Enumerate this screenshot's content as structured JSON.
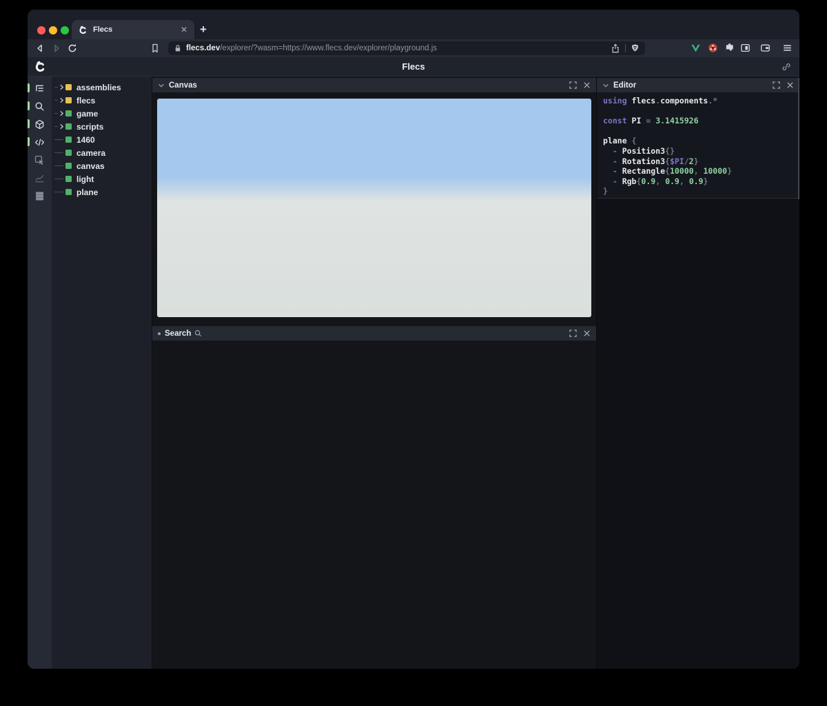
{
  "browser": {
    "tab_title": "Flecs",
    "new_tab_label": "+",
    "address": {
      "domain": "flecs.dev",
      "path": "/explorer/?wasm=https://www.flecs.dev/explorer/playground.js"
    }
  },
  "app_header": {
    "title": "Flecs"
  },
  "sidebar": {
    "icons": [
      {
        "name": "entity-tree",
        "active": true,
        "level": "bright"
      },
      {
        "name": "search",
        "active": true,
        "level": "bright"
      },
      {
        "name": "cube",
        "active": true,
        "level": "bright"
      },
      {
        "name": "code",
        "active": true,
        "level": "bright"
      },
      {
        "name": "inspect",
        "active": false,
        "level": "mid"
      },
      {
        "name": "stats",
        "active": false,
        "level": "dim"
      },
      {
        "name": "rows",
        "active": false,
        "level": "mid"
      }
    ]
  },
  "tree": {
    "items": [
      {
        "label": "assemblies",
        "color": "#e5c150",
        "expandable": true
      },
      {
        "label": "flecs",
        "color": "#e5c150",
        "expandable": true
      },
      {
        "label": "game",
        "color": "#50b26a",
        "expandable": true
      },
      {
        "label": "scripts",
        "color": "#50b26a",
        "expandable": true
      },
      {
        "label": "1460",
        "color": "#50b26a",
        "expandable": false
      },
      {
        "label": "camera",
        "color": "#50b26a",
        "expandable": false
      },
      {
        "label": "canvas",
        "color": "#50b26a",
        "expandable": false
      },
      {
        "label": "light",
        "color": "#50b26a",
        "expandable": false
      },
      {
        "label": "plane",
        "color": "#50b26a",
        "expandable": false
      }
    ]
  },
  "panels": {
    "canvas": {
      "title": "Canvas"
    },
    "search": {
      "title": "Search"
    },
    "editor": {
      "title": "Editor"
    }
  },
  "editor": {
    "lines": [
      [
        {
          "t": "using ",
          "c": "kw"
        },
        {
          "t": "flecs",
          "c": "id"
        },
        {
          "t": ".",
          "c": "p"
        },
        {
          "t": "components",
          "c": "id"
        },
        {
          "t": ".*",
          "c": "p"
        }
      ],
      [],
      [
        {
          "t": "const ",
          "c": "kw"
        },
        {
          "t": "PI ",
          "c": "id"
        },
        {
          "t": "= ",
          "c": "p"
        },
        {
          "t": "3.1415926",
          "c": "num"
        }
      ],
      [],
      [
        {
          "t": "plane ",
          "c": "id"
        },
        {
          "t": "{",
          "c": "p"
        }
      ],
      [
        {
          "t": "  - ",
          "c": "p"
        },
        {
          "t": "Position3",
          "c": "id"
        },
        {
          "t": "{}",
          "c": "p"
        }
      ],
      [
        {
          "t": "  - ",
          "c": "p"
        },
        {
          "t": "Rotation3",
          "c": "id"
        },
        {
          "t": "{",
          "c": "p"
        },
        {
          "t": "$PI",
          "c": "var"
        },
        {
          "t": "/",
          "c": "p"
        },
        {
          "t": "2",
          "c": "num"
        },
        {
          "t": "}",
          "c": "p"
        }
      ],
      [
        {
          "t": "  - ",
          "c": "p"
        },
        {
          "t": "Rectangle",
          "c": "id"
        },
        {
          "t": "{",
          "c": "p"
        },
        {
          "t": "10000",
          "c": "num"
        },
        {
          "t": ", ",
          "c": "p"
        },
        {
          "t": "10000",
          "c": "num"
        },
        {
          "t": "}",
          "c": "p"
        }
      ],
      [
        {
          "t": "  - ",
          "c": "p"
        },
        {
          "t": "Rgb",
          "c": "id"
        },
        {
          "t": "{",
          "c": "p"
        },
        {
          "t": "0.9",
          "c": "num"
        },
        {
          "t": ", ",
          "c": "p"
        },
        {
          "t": "0.9",
          "c": "num"
        },
        {
          "t": ", ",
          "c": "p"
        },
        {
          "t": "0.9",
          "c": "num"
        },
        {
          "t": "}",
          "c": "p"
        }
      ],
      [
        {
          "t": "}",
          "c": "p"
        }
      ]
    ]
  },
  "colors": {
    "accent_green_pill": "#a9d7a2",
    "entity_yellow": "#e5c150",
    "entity_green": "#50b26a",
    "canvas_sky": "#a4c8ee",
    "canvas_horizon": "#dfe4e2",
    "canvas_ground": "#d9dfdc",
    "code_keyword": "#7d73c9",
    "code_number": "#8fd3a0",
    "code_identifier": "#e8eaed",
    "code_punctuation": "#6f7683"
  }
}
